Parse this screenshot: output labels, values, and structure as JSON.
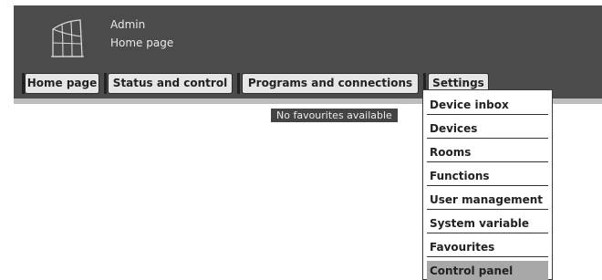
{
  "header": {
    "user": "Admin",
    "page": "Home page"
  },
  "nav": {
    "items": [
      {
        "label": "Home page"
      },
      {
        "label": "Status and control"
      },
      {
        "label": "Programs and connections"
      },
      {
        "label": "Settings"
      }
    ]
  },
  "main": {
    "no_favourites": "No favourites available"
  },
  "settings_menu": {
    "items": [
      {
        "label": "Device inbox"
      },
      {
        "label": "Devices"
      },
      {
        "label": "Rooms"
      },
      {
        "label": "Functions"
      },
      {
        "label": "User management"
      },
      {
        "label": "System variable"
      },
      {
        "label": "Favourites"
      },
      {
        "label": "Control panel",
        "active": true
      }
    ]
  }
}
